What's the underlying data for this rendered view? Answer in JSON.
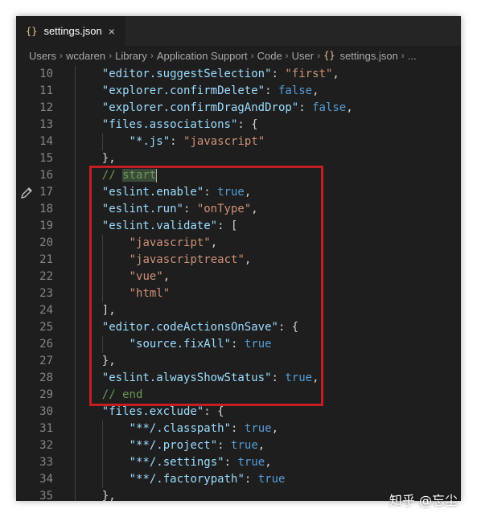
{
  "tab": {
    "icon_text": "{}",
    "title": "settings.json",
    "close_glyph": "×"
  },
  "breadcrumb": {
    "items": [
      "Users",
      "wcdaren",
      "Library",
      "Application Support",
      "Code",
      "User"
    ],
    "file": "settings.json",
    "ellipsis": "..."
  },
  "colors": {
    "key": "#9cdcfe",
    "string": "#ce9178",
    "boolean": "#569cd6",
    "comment": "#6a9955",
    "highlight_box": "#c41e23"
  },
  "lines": [
    {
      "n": "10",
      "indent": 1,
      "tokens": [
        [
          "k",
          "\"editor.suggestSelection\""
        ],
        [
          "p",
          ": "
        ],
        [
          "s",
          "\"first\""
        ],
        [
          "p",
          ","
        ]
      ]
    },
    {
      "n": "11",
      "indent": 1,
      "tokens": [
        [
          "k",
          "\"explorer.confirmDelete\""
        ],
        [
          "p",
          ": "
        ],
        [
          "b",
          "false"
        ],
        [
          "p",
          ","
        ]
      ]
    },
    {
      "n": "12",
      "indent": 1,
      "tokens": [
        [
          "k",
          "\"explorer.confirmDragAndDrop\""
        ],
        [
          "p",
          ": "
        ],
        [
          "b",
          "false"
        ],
        [
          "p",
          ","
        ]
      ]
    },
    {
      "n": "13",
      "indent": 1,
      "tokens": [
        [
          "k",
          "\"files.associations\""
        ],
        [
          "p",
          ": {"
        ]
      ]
    },
    {
      "n": "14",
      "indent": 2,
      "tokens": [
        [
          "k",
          "\"*.js\""
        ],
        [
          "p",
          ": "
        ],
        [
          "s",
          "\"javascript\""
        ]
      ]
    },
    {
      "n": "15",
      "indent": 1,
      "tokens": [
        [
          "p",
          "},"
        ]
      ]
    },
    {
      "n": "16",
      "indent": 1,
      "tokens": [
        [
          "c",
          "// "
        ],
        [
          "c",
          "start"
        ]
      ],
      "cursor": true
    },
    {
      "n": "17",
      "indent": 1,
      "tokens": [
        [
          "k",
          "\"eslint.enable\""
        ],
        [
          "p",
          ": "
        ],
        [
          "b",
          "true"
        ],
        [
          "p",
          ","
        ]
      ],
      "pencil": true
    },
    {
      "n": "18",
      "indent": 1,
      "tokens": [
        [
          "k",
          "\"eslint.run\""
        ],
        [
          "p",
          ": "
        ],
        [
          "s",
          "\"onType\""
        ],
        [
          "p",
          ","
        ]
      ]
    },
    {
      "n": "19",
      "indent": 1,
      "tokens": [
        [
          "k",
          "\"eslint.validate\""
        ],
        [
          "p",
          ": ["
        ]
      ]
    },
    {
      "n": "20",
      "indent": 2,
      "tokens": [
        [
          "s",
          "\"javascript\""
        ],
        [
          "p",
          ","
        ]
      ]
    },
    {
      "n": "21",
      "indent": 2,
      "tokens": [
        [
          "s",
          "\"javascriptreact\""
        ],
        [
          "p",
          ","
        ]
      ]
    },
    {
      "n": "22",
      "indent": 2,
      "tokens": [
        [
          "s",
          "\"vue\""
        ],
        [
          "p",
          ","
        ]
      ]
    },
    {
      "n": "23",
      "indent": 2,
      "tokens": [
        [
          "s",
          "\"html\""
        ]
      ]
    },
    {
      "n": "24",
      "indent": 1,
      "tokens": [
        [
          "p",
          "],"
        ]
      ]
    },
    {
      "n": "25",
      "indent": 1,
      "tokens": [
        [
          "k",
          "\"editor.codeActionsOnSave\""
        ],
        [
          "p",
          ": {"
        ]
      ]
    },
    {
      "n": "26",
      "indent": 2,
      "tokens": [
        [
          "k",
          "\"source.fixAll\""
        ],
        [
          "p",
          ": "
        ],
        [
          "b",
          "true"
        ]
      ]
    },
    {
      "n": "27",
      "indent": 1,
      "tokens": [
        [
          "p",
          "},"
        ]
      ]
    },
    {
      "n": "28",
      "indent": 1,
      "tokens": [
        [
          "k",
          "\"eslint.alwaysShowStatus\""
        ],
        [
          "p",
          ": "
        ],
        [
          "b",
          "true"
        ],
        [
          "p",
          ","
        ]
      ]
    },
    {
      "n": "29",
      "indent": 1,
      "tokens": [
        [
          "c",
          "// end"
        ]
      ]
    },
    {
      "n": "30",
      "indent": 1,
      "tokens": [
        [
          "k",
          "\"files.exclude\""
        ],
        [
          "p",
          ": {"
        ]
      ]
    },
    {
      "n": "31",
      "indent": 2,
      "tokens": [
        [
          "k",
          "\"**/.classpath\""
        ],
        [
          "p",
          ": "
        ],
        [
          "b",
          "true"
        ],
        [
          "p",
          ","
        ]
      ]
    },
    {
      "n": "32",
      "indent": 2,
      "tokens": [
        [
          "k",
          "\"**/.project\""
        ],
        [
          "p",
          ": "
        ],
        [
          "b",
          "true"
        ],
        [
          "p",
          ","
        ]
      ]
    },
    {
      "n": "33",
      "indent": 2,
      "tokens": [
        [
          "k",
          "\"**/.settings\""
        ],
        [
          "p",
          ": "
        ],
        [
          "b",
          "true"
        ],
        [
          "p",
          ","
        ]
      ]
    },
    {
      "n": "34",
      "indent": 2,
      "tokens": [
        [
          "k",
          "\"**/.factorypath\""
        ],
        [
          "p",
          ": "
        ],
        [
          "b",
          "true"
        ]
      ]
    },
    {
      "n": "35",
      "indent": 1,
      "tokens": [
        [
          "p",
          "},"
        ]
      ]
    }
  ],
  "watermark": "知乎 @忘尘"
}
